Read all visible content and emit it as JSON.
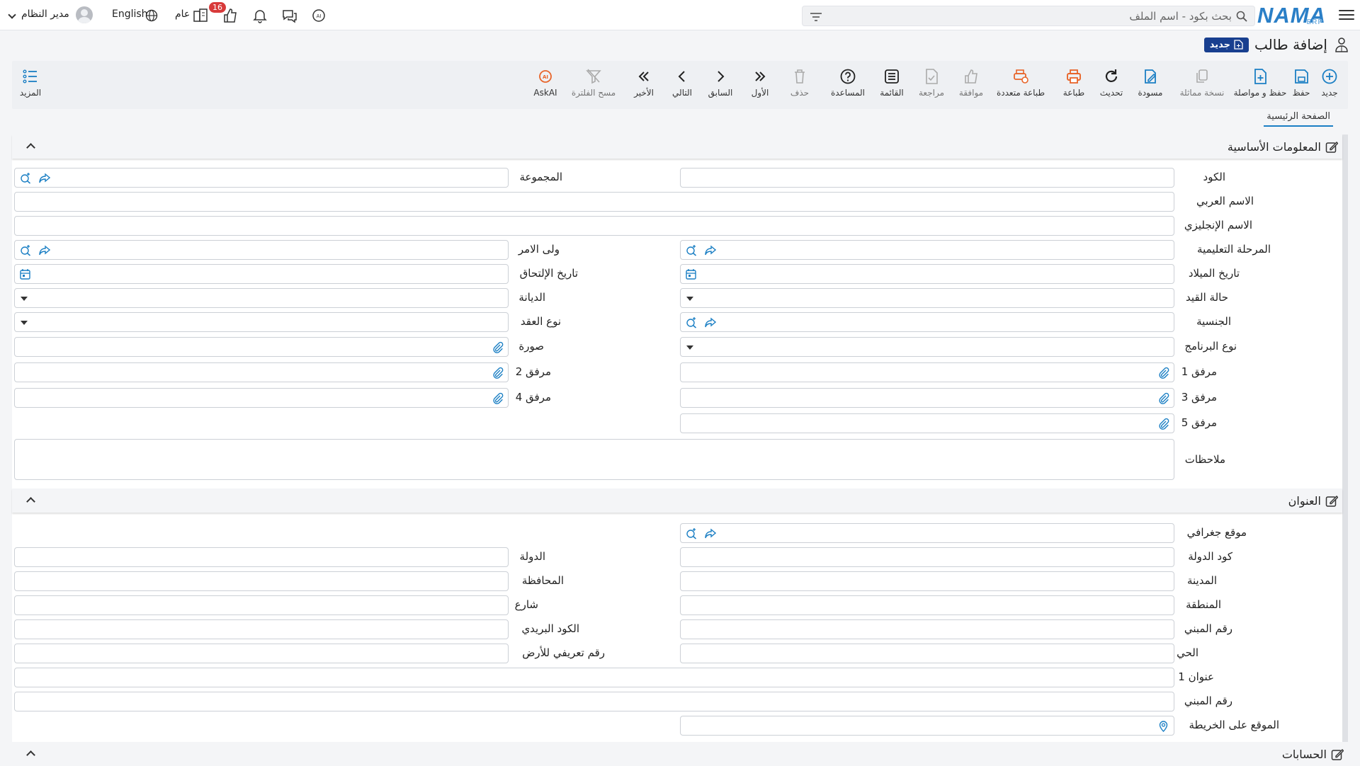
{
  "topbar": {
    "logo": "NAMA",
    "logo_sub": "ERP",
    "search_placeholder": "بحث بكود - اسم الملف",
    "notification_count": "16",
    "general_label": "عام",
    "language_label": "English",
    "user_name": "مدير النظام"
  },
  "page": {
    "title": "إضافة طالب",
    "new_tag": "جديد"
  },
  "toolbar": {
    "new": "جديد",
    "save": "حفظ",
    "save_continue": "حفظ و مواصلة",
    "duplicate": "نسخة مماثلة",
    "draft": "مسودة",
    "refresh": "تحديث",
    "print": "طباعة",
    "multi_print": "طباعة متعددة",
    "approve": "موافقة",
    "review": "مراجعة",
    "list": "القائمة",
    "help": "المساعدة",
    "delete": "حذف",
    "first": "الأول",
    "previous": "السابق",
    "next": "التالي",
    "last": "الأخير",
    "clear_filter": "مسح الفلترة",
    "askai": "AskAI",
    "more": "المزيد"
  },
  "tabs": {
    "main": "الصفحة الرئيسية"
  },
  "basic_info": {
    "title": "المعلومات الأساسية",
    "code": "الكود",
    "group": "المجموعة",
    "arabic_name": "الاسم العربي",
    "english_name": "الاسم الإنجليزي",
    "education_stage": "المرحلة التعليمية",
    "guardian": "ولى الامر",
    "birth_date": "تاريخ الميلاد",
    "enroll_date": "تاريخ الإلتحاق",
    "registration_status": "حالة القيد",
    "religion": "الديانة",
    "nationality": "الجنسية",
    "contract_type": "نوع العقد",
    "program_type": "نوع البرنامج",
    "photo": "صورة",
    "attachment1": "مرفق 1",
    "attachment2": "مرفق 2",
    "attachment3": "مرفق 3",
    "attachment4": "مرفق 4",
    "attachment5": "مرفق 5",
    "notes": "ملاحظات"
  },
  "address": {
    "title": "العنوان",
    "geo_location": "موقع جغرافي",
    "country_code": "كود الدولة",
    "country": "الدولة",
    "city": "المدينة",
    "province": "المحافظة",
    "district": "المنطقة",
    "street": "شارع",
    "building_no": "رقم المبني",
    "postal_code": "الكود البريدي",
    "neighborhood": "الحي",
    "land_id": "رقم تعريفي للأرض",
    "address1": "عنوان 1",
    "building_no2": "رقم المبني",
    "map_location": "الموقع على الخريطة"
  },
  "accounts": {
    "title": "الحسابات"
  },
  "colors": {
    "primary": "#1b7fc4",
    "orange": "#e8652a",
    "navy": "#183f8f",
    "badge": "#d83a3a"
  }
}
